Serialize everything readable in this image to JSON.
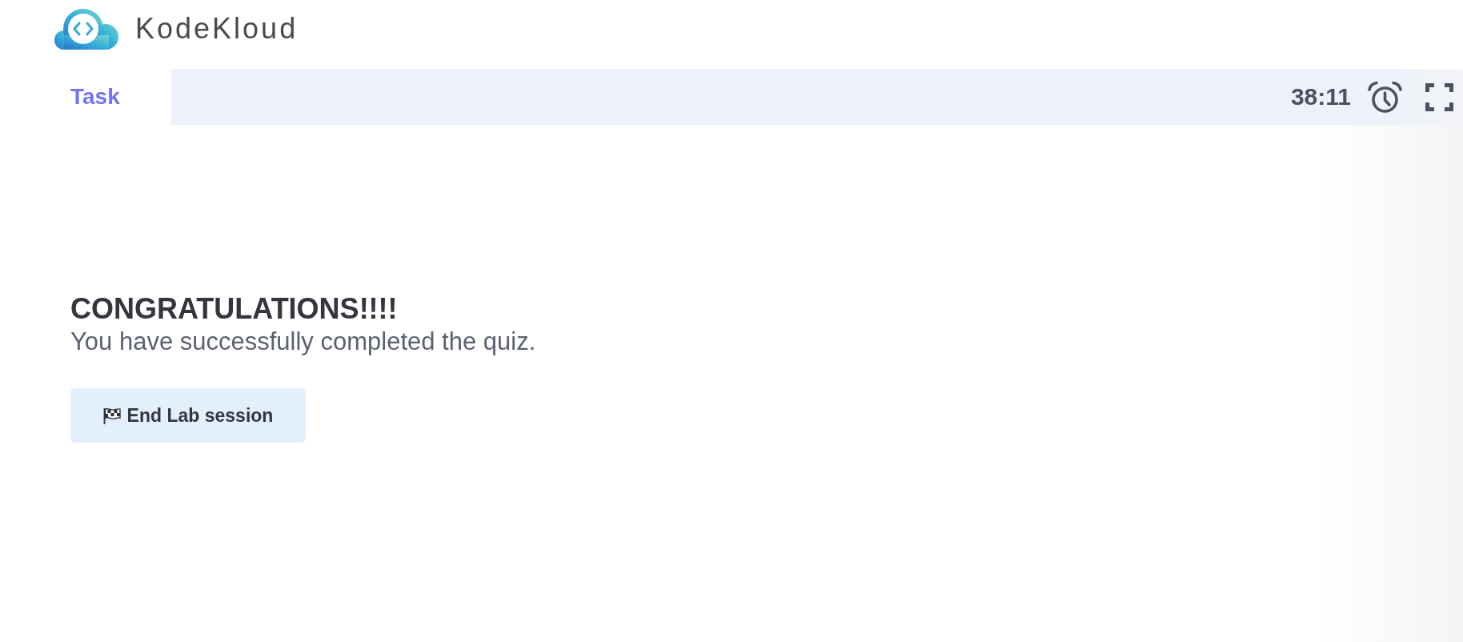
{
  "logo": {
    "text": "KodeKloud"
  },
  "tabs": [
    {
      "label": "Task",
      "selected": true
    }
  ],
  "toolbar": {
    "timer": "38:11"
  },
  "message": {
    "heading": "CONGRATULATIONS!!!!",
    "text": "You have successfully completed the quiz."
  },
  "buttons": [
    {
      "label": "End Lab session"
    }
  ]
}
